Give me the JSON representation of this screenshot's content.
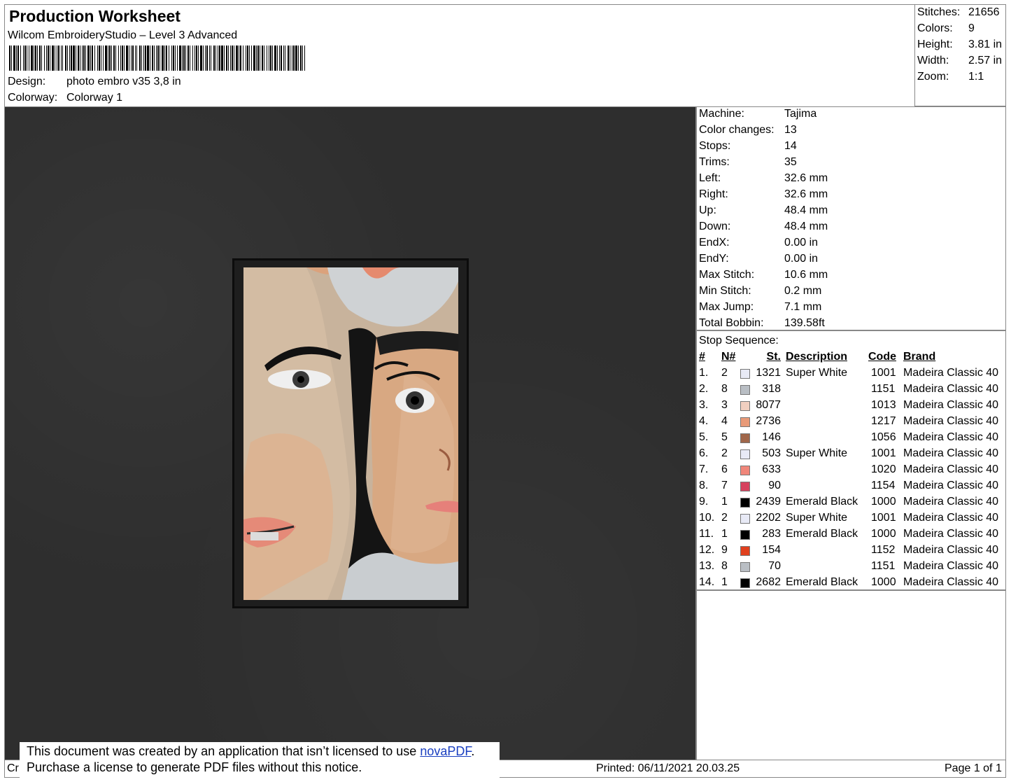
{
  "header": {
    "title": "Production Worksheet",
    "software": "Wilcom EmbroideryStudio – Level 3 Advanced",
    "design_label": "Design:",
    "design_value": "photo embro v35 3,8 in",
    "colorway_label": "Colorway:",
    "colorway_value": "Colorway 1"
  },
  "summary": [
    {
      "label": "Stitches:",
      "value": "21656"
    },
    {
      "label": "Colors:",
      "value": "9"
    },
    {
      "label": "Height:",
      "value": "3.81 in"
    },
    {
      "label": "Width:",
      "value": "2.57 in"
    },
    {
      "label": "Zoom:",
      "value": "1:1"
    }
  ],
  "machine": [
    {
      "label": "Machine:",
      "value": "Tajima"
    },
    {
      "label": "Color changes:",
      "value": "13"
    },
    {
      "label": "Stops:",
      "value": "14"
    },
    {
      "label": "Trims:",
      "value": "35"
    },
    {
      "label": "Left:",
      "value": "32.6 mm"
    },
    {
      "label": "Right:",
      "value": "32.6 mm"
    },
    {
      "label": "Up:",
      "value": "48.4 mm"
    },
    {
      "label": "Down:",
      "value": "48.4 mm"
    },
    {
      "label": "EndX:",
      "value": "0.00 in"
    },
    {
      "label": "EndY:",
      "value": "0.00 in"
    },
    {
      "label": "Max Stitch:",
      "value": "10.6 mm"
    },
    {
      "label": "Min Stitch:",
      "value": "0.2 mm"
    },
    {
      "label": "Max Jump:",
      "value": "7.1 mm"
    },
    {
      "label": "Total Bobbin:",
      "value": "139.58ft"
    }
  ],
  "stop_sequence": {
    "title": "Stop Sequence:",
    "headers": {
      "idx": "#",
      "needle": "N#",
      "st": "St.",
      "desc": "Description",
      "code": "Code",
      "brand": "Brand"
    },
    "rows": [
      {
        "idx": "1.",
        "needle": "2",
        "color": "#e8eaf6",
        "st": "1321",
        "desc": "Super White",
        "code": "1001",
        "brand": "Madeira Classic 40"
      },
      {
        "idx": "2.",
        "needle": "8",
        "color": "#b9bec4",
        "st": "318",
        "desc": "",
        "code": "1151",
        "brand": "Madeira Classic 40"
      },
      {
        "idx": "3.",
        "needle": "3",
        "color": "#f1cfc0",
        "st": "8077",
        "desc": "",
        "code": "1013",
        "brand": "Madeira Classic 40"
      },
      {
        "idx": "4.",
        "needle": "4",
        "color": "#e89a78",
        "st": "2736",
        "desc": "",
        "code": "1217",
        "brand": "Madeira Classic 40"
      },
      {
        "idx": "5.",
        "needle": "5",
        "color": "#a0664a",
        "st": "146",
        "desc": "",
        "code": "1056",
        "brand": "Madeira Classic 40"
      },
      {
        "idx": "6.",
        "needle": "2",
        "color": "#e8eaf6",
        "st": "503",
        "desc": "Super White",
        "code": "1001",
        "brand": "Madeira Classic 40"
      },
      {
        "idx": "7.",
        "needle": "6",
        "color": "#f0867a",
        "st": "633",
        "desc": "",
        "code": "1020",
        "brand": "Madeira Classic 40"
      },
      {
        "idx": "8.",
        "needle": "7",
        "color": "#d6425e",
        "st": "90",
        "desc": "",
        "code": "1154",
        "brand": "Madeira Classic 40"
      },
      {
        "idx": "9.",
        "needle": "1",
        "color": "#000000",
        "st": "2439",
        "desc": "Emerald Black",
        "code": "1000",
        "brand": "Madeira Classic 40"
      },
      {
        "idx": "10.",
        "needle": "2",
        "color": "#e8eaf6",
        "st": "2202",
        "desc": "Super White",
        "code": "1001",
        "brand": "Madeira Classic 40"
      },
      {
        "idx": "11.",
        "needle": "1",
        "color": "#000000",
        "st": "283",
        "desc": "Emerald Black",
        "code": "1000",
        "brand": "Madeira Classic 40"
      },
      {
        "idx": "12.",
        "needle": "9",
        "color": "#e0401e",
        "st": "154",
        "desc": "",
        "code": "1152",
        "brand": "Madeira Classic 40"
      },
      {
        "idx": "13.",
        "needle": "8",
        "color": "#b9bec4",
        "st": "70",
        "desc": "",
        "code": "1151",
        "brand": "Madeira Classic 40"
      },
      {
        "idx": "14.",
        "needle": "1",
        "color": "#000000",
        "st": "2682",
        "desc": "Emerald Black",
        "code": "1000",
        "brand": "Madeira Classic 40"
      }
    ]
  },
  "footer": {
    "left": "Cr",
    "printed": "Printed: 06/11/2021 20.03.25",
    "page": "Page 1 of 1"
  },
  "notice": {
    "line1_pre": "This document was created by an application that isn’t licensed to use ",
    "link": "novaPDF",
    "line1_post": ".",
    "line2": "Purchase a license to generate PDF files without this notice."
  }
}
